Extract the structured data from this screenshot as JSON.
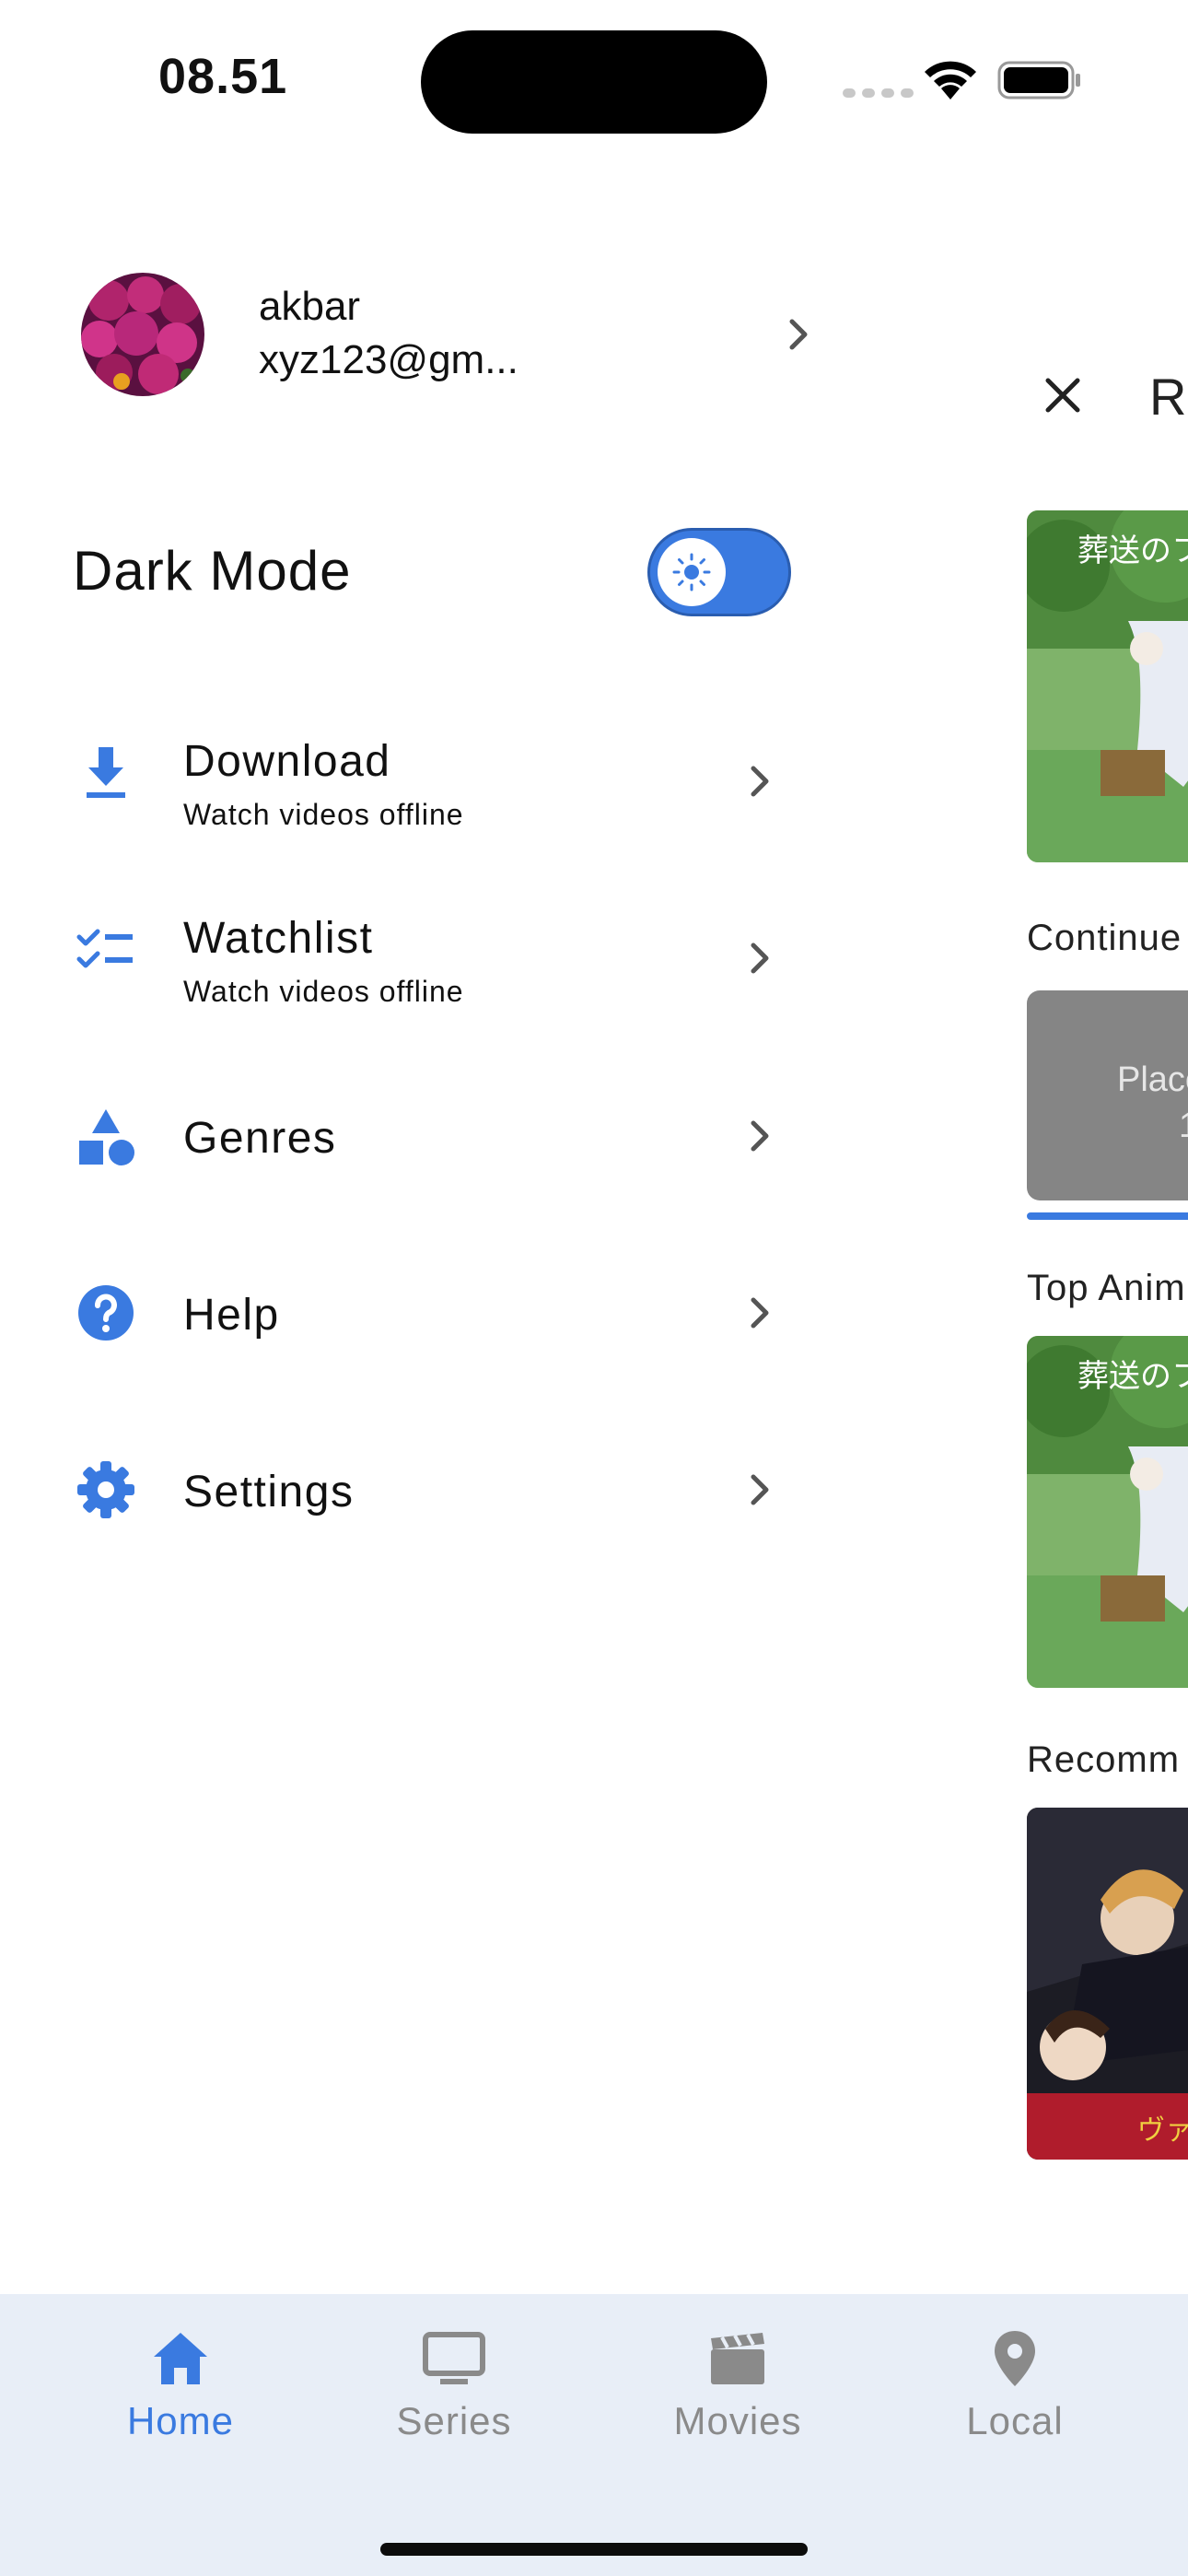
{
  "status_bar": {
    "time": "08.51"
  },
  "profile": {
    "name": "akbar",
    "email": "xyz123@gm..."
  },
  "dark_mode": {
    "label": "Dark Mode",
    "enabled": true
  },
  "menu": {
    "items": [
      {
        "title": "Download",
        "subtitle": "Watch videos offline",
        "icon": "download-icon"
      },
      {
        "title": "Watchlist",
        "subtitle": "Watch videos offline",
        "icon": "checklist-icon"
      },
      {
        "title": "Genres",
        "subtitle": "",
        "icon": "category-shapes-icon"
      },
      {
        "title": "Help",
        "subtitle": "",
        "icon": "help-circle-icon"
      },
      {
        "title": "Settings",
        "subtitle": "",
        "icon": "gear-icon"
      }
    ]
  },
  "main": {
    "title_partial": "Re",
    "sections": {
      "continue": "Continue",
      "top": "Top Anim",
      "recommended": "Recomm"
    },
    "placeholder": {
      "text": "Placeh",
      "number": "1"
    }
  },
  "bottom_nav": {
    "items": [
      {
        "label": "Home",
        "icon": "home-icon",
        "active": true
      },
      {
        "label": "Series",
        "icon": "tv-icon",
        "active": false
      },
      {
        "label": "Movies",
        "icon": "clapperboard-icon",
        "active": false
      },
      {
        "label": "Local",
        "icon": "location-pin-icon",
        "active": false
      }
    ]
  },
  "colors": {
    "accent": "#3a7ae0",
    "nav_background": "#e8eef7",
    "inactive": "#8a8a8a"
  }
}
